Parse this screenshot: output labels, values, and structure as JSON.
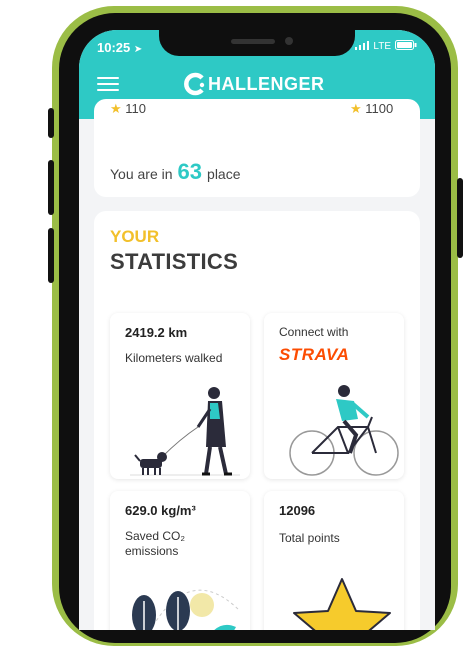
{
  "status_bar": {
    "time": "10:25",
    "network": "LTE"
  },
  "header": {
    "brand_initial": "C",
    "brand_rest": "HALLENGER",
    "accent_color": "#2ec9c5"
  },
  "ranking": {
    "left_points": "110",
    "right_points": "1100",
    "place_prefix": "You are in",
    "place_number": "63",
    "place_suffix": "place"
  },
  "statistics": {
    "title_your": "YOUR",
    "title_main": "STATISTICS",
    "tiles": [
      {
        "value": "2419.2 km",
        "label": "Kilometers walked"
      },
      {
        "connect_label": "Connect with",
        "brand": "STRAVA",
        "brand_color": "#fc4c02"
      },
      {
        "value": "629.0 kg/m³",
        "label": "Saved CO₂ emissions"
      },
      {
        "value": "12096",
        "label": "Total points"
      }
    ]
  }
}
